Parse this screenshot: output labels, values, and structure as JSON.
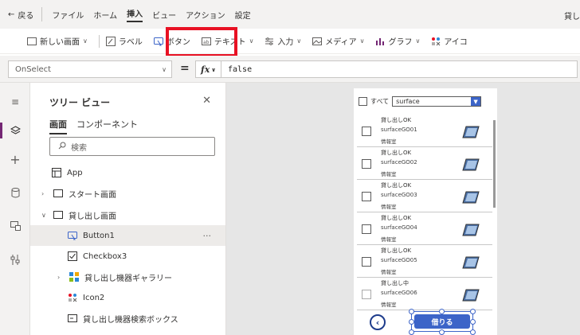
{
  "menubar": {
    "back_label": "戻る",
    "items": [
      "ファイル",
      "ホーム",
      "挿入",
      "ビュー",
      "アクション",
      "設定"
    ],
    "active_index": 2,
    "right_label": "貸し"
  },
  "toolbar": {
    "new_screen": "新しい画面",
    "label": "ラベル",
    "button": "ボタン",
    "text": "テキスト",
    "input": "入力",
    "media": "メディア",
    "chart": "グラフ",
    "icon": "アイコ"
  },
  "formula": {
    "property": "OnSelect",
    "equals": "=",
    "fx": "fx",
    "value": "false"
  },
  "tree": {
    "title": "ツリー ビュー",
    "tabs": [
      "画面",
      "コンポーネント"
    ],
    "search_placeholder": "検索",
    "items": [
      {
        "label": "App"
      },
      {
        "label": "スタート画面"
      },
      {
        "label": "貸し出し画面"
      },
      {
        "label": "Button1"
      },
      {
        "label": "Checkbox3"
      },
      {
        "label": "貸し出し機器ギャラリー"
      },
      {
        "label": "Icon2"
      },
      {
        "label": "貸し出し機器検索ボックス"
      }
    ],
    "more": "···"
  },
  "app": {
    "all_label": "すべて",
    "filter_value": "surface",
    "rows": [
      {
        "status": "貸し出しOK",
        "name": "surfaceGO01",
        "dept": "情報室"
      },
      {
        "status": "貸し出しOK",
        "name": "surfaceGO02",
        "dept": "情報室"
      },
      {
        "status": "貸し出しOK",
        "name": "surfaceGO03",
        "dept": "情報室"
      },
      {
        "status": "貸し出しOK",
        "name": "surfaceGO04",
        "dept": "情報室"
      },
      {
        "status": "貸し出しOK",
        "name": "surfaceGO05",
        "dept": "情報室"
      },
      {
        "status": "貸し出し中",
        "name": "surfaceGO06",
        "dept": "情報室"
      }
    ],
    "rent_button": "借りる"
  }
}
